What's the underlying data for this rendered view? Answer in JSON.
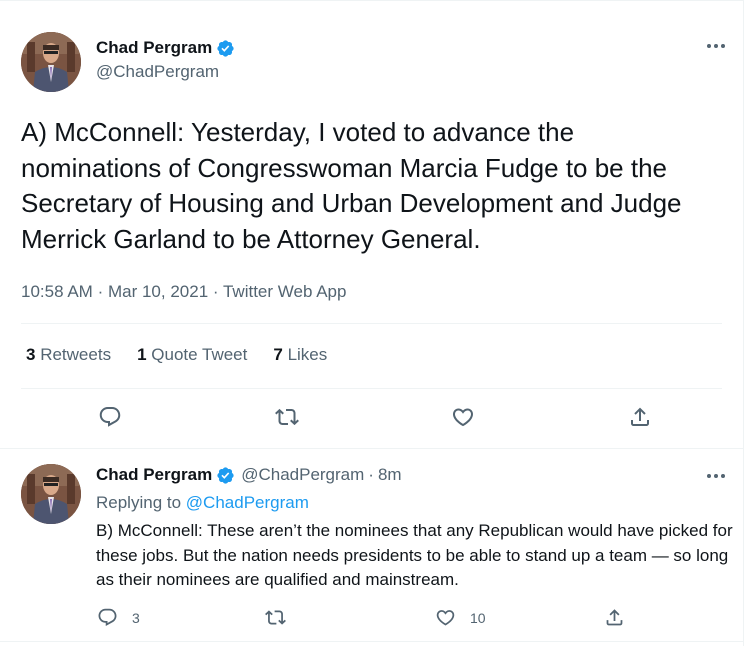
{
  "main_tweet": {
    "author_name": "Chad Pergram",
    "author_handle": "@ChadPergram",
    "text": "A) McConnell: Yesterday, I voted to advance the nominations of Congresswoman Marcia Fudge to be the Secretary of Housing and Urban Development and Judge Merrick Garland to be Attorney General.",
    "time": "10:58 AM",
    "date": "Mar 10, 2021",
    "source": "Twitter Web App",
    "separator": "·",
    "stats": {
      "retweets_count": "3",
      "retweets_label": "Retweets",
      "quote_count": "1",
      "quote_label": "Quote Tweet",
      "likes_count": "7",
      "likes_label": "Likes"
    }
  },
  "reply_tweet": {
    "author_name": "Chad Pergram",
    "author_handle": "@ChadPergram",
    "separator": "·",
    "age": "8m",
    "replying_label": "Replying to",
    "replying_handle": "@ChadPergram",
    "text": "B) McConnell: These aren’t the nominees that any Republican would have picked for these jobs. But the nation needs presidents to be able to stand up a team — so long as their nominees are qualified and mainstream.",
    "reply_count": "3",
    "like_count": "10"
  },
  "colors": {
    "accent": "#1d9bf0",
    "secondary_text": "#536471",
    "primary_text": "#0f1419"
  },
  "icons": [
    "verified-badge-icon",
    "more-icon",
    "reply-icon",
    "retweet-icon",
    "like-icon",
    "share-icon"
  ]
}
